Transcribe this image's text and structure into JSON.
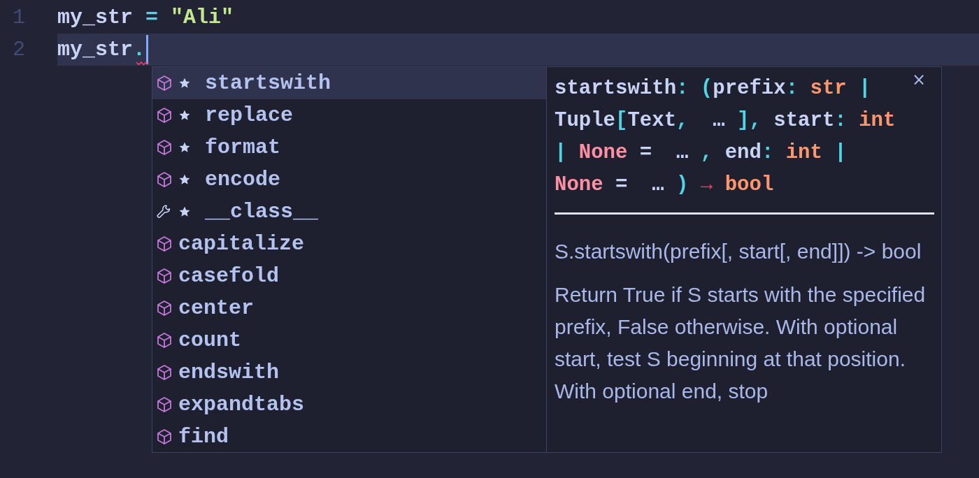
{
  "editor": {
    "lines": [
      {
        "number": "1",
        "current": false,
        "tokens": [
          {
            "text": "my_str",
            "kind": "name"
          },
          {
            "text": " = ",
            "kind": "punct"
          },
          {
            "text": "\"Ali\"",
            "kind": "string"
          }
        ]
      },
      {
        "number": "2",
        "current": true,
        "tokens": [
          {
            "text": "my_str",
            "kind": "name"
          },
          {
            "text": ".",
            "kind": "punct"
          }
        ]
      }
    ]
  },
  "completions": {
    "items": [
      {
        "label": "startswith",
        "kind": "method",
        "starred": true,
        "selected": true
      },
      {
        "label": "replace",
        "kind": "method",
        "starred": true,
        "selected": false
      },
      {
        "label": "format",
        "kind": "method",
        "starred": true,
        "selected": false
      },
      {
        "label": "encode",
        "kind": "method",
        "starred": true,
        "selected": false
      },
      {
        "label": "__class__",
        "kind": "property",
        "starred": true,
        "selected": false
      },
      {
        "label": "capitalize",
        "kind": "method",
        "starred": false,
        "selected": false
      },
      {
        "label": "casefold",
        "kind": "method",
        "starred": false,
        "selected": false
      },
      {
        "label": "center",
        "kind": "method",
        "starred": false,
        "selected": false
      },
      {
        "label": "count",
        "kind": "method",
        "starred": false,
        "selected": false
      },
      {
        "label": "endswith",
        "kind": "method",
        "starred": false,
        "selected": false
      },
      {
        "label": "expandtabs",
        "kind": "method",
        "starred": false,
        "selected": false
      },
      {
        "label": "find",
        "kind": "method",
        "starred": false,
        "selected": false
      }
    ],
    "details": {
      "close": "×",
      "signature": [
        [
          {
            "text": "startswith",
            "kind": "name"
          },
          {
            "text": ": (",
            "kind": "punct"
          },
          {
            "text": "prefix",
            "kind": "name"
          },
          {
            "text": ": ",
            "kind": "punct"
          },
          {
            "text": "str",
            "kind": "type"
          },
          {
            "text": " |",
            "kind": "punct"
          }
        ],
        [
          {
            "text": "Tuple",
            "kind": "name"
          },
          {
            "text": "[",
            "kind": "punct"
          },
          {
            "text": "Text",
            "kind": "name"
          },
          {
            "text": ", ",
            "kind": "punct"
          },
          {
            "text": " … ",
            "kind": "name"
          },
          {
            "text": "], ",
            "kind": "punct"
          },
          {
            "text": "start",
            "kind": "name"
          },
          {
            "text": ": ",
            "kind": "punct"
          },
          {
            "text": "int",
            "kind": "type"
          }
        ],
        [
          {
            "text": "| ",
            "kind": "punct"
          },
          {
            "text": "None",
            "kind": "none"
          },
          {
            "text": " =  … ",
            "kind": "name"
          },
          {
            "text": ", ",
            "kind": "punct"
          },
          {
            "text": "end",
            "kind": "name"
          },
          {
            "text": ": ",
            "kind": "punct"
          },
          {
            "text": "int",
            "kind": "type"
          },
          {
            "text": " |",
            "kind": "punct"
          }
        ],
        [
          {
            "text": "None",
            "kind": "none"
          },
          {
            "text": " =  … ",
            "kind": "name"
          },
          {
            "text": ")",
            "kind": "punct"
          },
          {
            "text": " → ",
            "kind": "arrow"
          },
          {
            "text": "bool",
            "kind": "type"
          }
        ]
      ],
      "paragraphs": [
        "S.startswith(prefix[, start[, end]]) -> bool",
        "Return True if S starts with the specified prefix, False otherwise. With optional start, test S beginning at that position. With optional end, stop"
      ]
    }
  }
}
